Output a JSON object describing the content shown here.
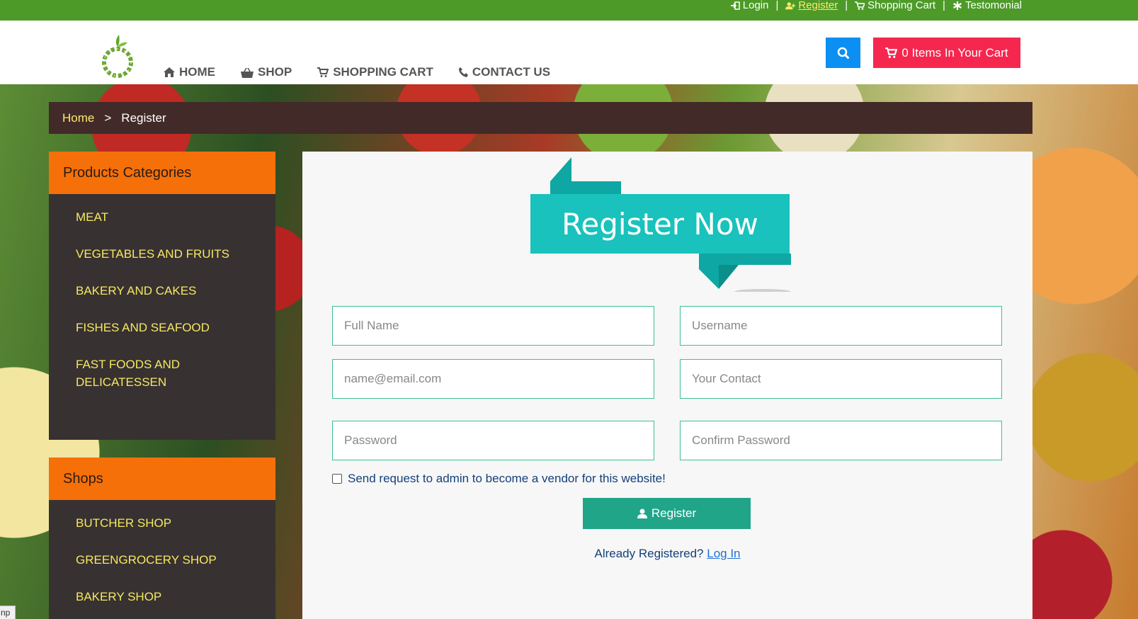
{
  "topbar": {
    "links": [
      {
        "label": "Login",
        "icon": "sign-in-icon"
      },
      {
        "label": "Register",
        "icon": "user-plus-icon"
      },
      {
        "label": "Shopping Cart",
        "icon": "cart-icon"
      },
      {
        "label": "Testomonial",
        "icon": "asterisk-icon"
      }
    ],
    "separator": "|"
  },
  "nav": {
    "home": "HOME",
    "shop": "SHOP",
    "cart": "SHOPPING CART",
    "contact": "CONTACT US"
  },
  "header": {
    "cart_button": "0 Items In Your Cart"
  },
  "breadcrumb": {
    "home": "Home",
    "separator": ">",
    "current": "Register"
  },
  "sidebar": {
    "categories_title": "Products Categories",
    "categories": [
      "MEAT",
      "VEGETABLES AND FRUITS",
      "BAKERY AND CAKES",
      "FISHES AND SEAFOOD",
      "FAST FOODS AND DELICATESSEN"
    ],
    "shops_title": "Shops",
    "shops": [
      "BUTCHER SHOP",
      "GREENGROCERY SHOP",
      "BAKERY SHOP"
    ]
  },
  "form": {
    "banner": "Register Now",
    "full_name_placeholder": "Full Name",
    "username_placeholder": "Username",
    "email_placeholder": "name@email.com",
    "contact_placeholder": "Your Contact",
    "password_placeholder": "Password",
    "confirm_placeholder": "Confirm  Password",
    "vendor_label": "Send request to admin to become a vendor for this website!",
    "register_button": "Register",
    "already_text": "Already Registered?",
    "login_link": "Log In"
  },
  "colors": {
    "topbar": "#4d9a29",
    "search": "#0c8ff2",
    "cart": "#f5274f",
    "breadcrumb": "#412a28",
    "sidebar_head": "#f57009",
    "sidebar_body": "#373132",
    "sidebar_link": "#f5e95f",
    "register_button": "#20a589",
    "banner": "#19c2bc"
  },
  "statusbar": {
    "corner_text": "np"
  }
}
